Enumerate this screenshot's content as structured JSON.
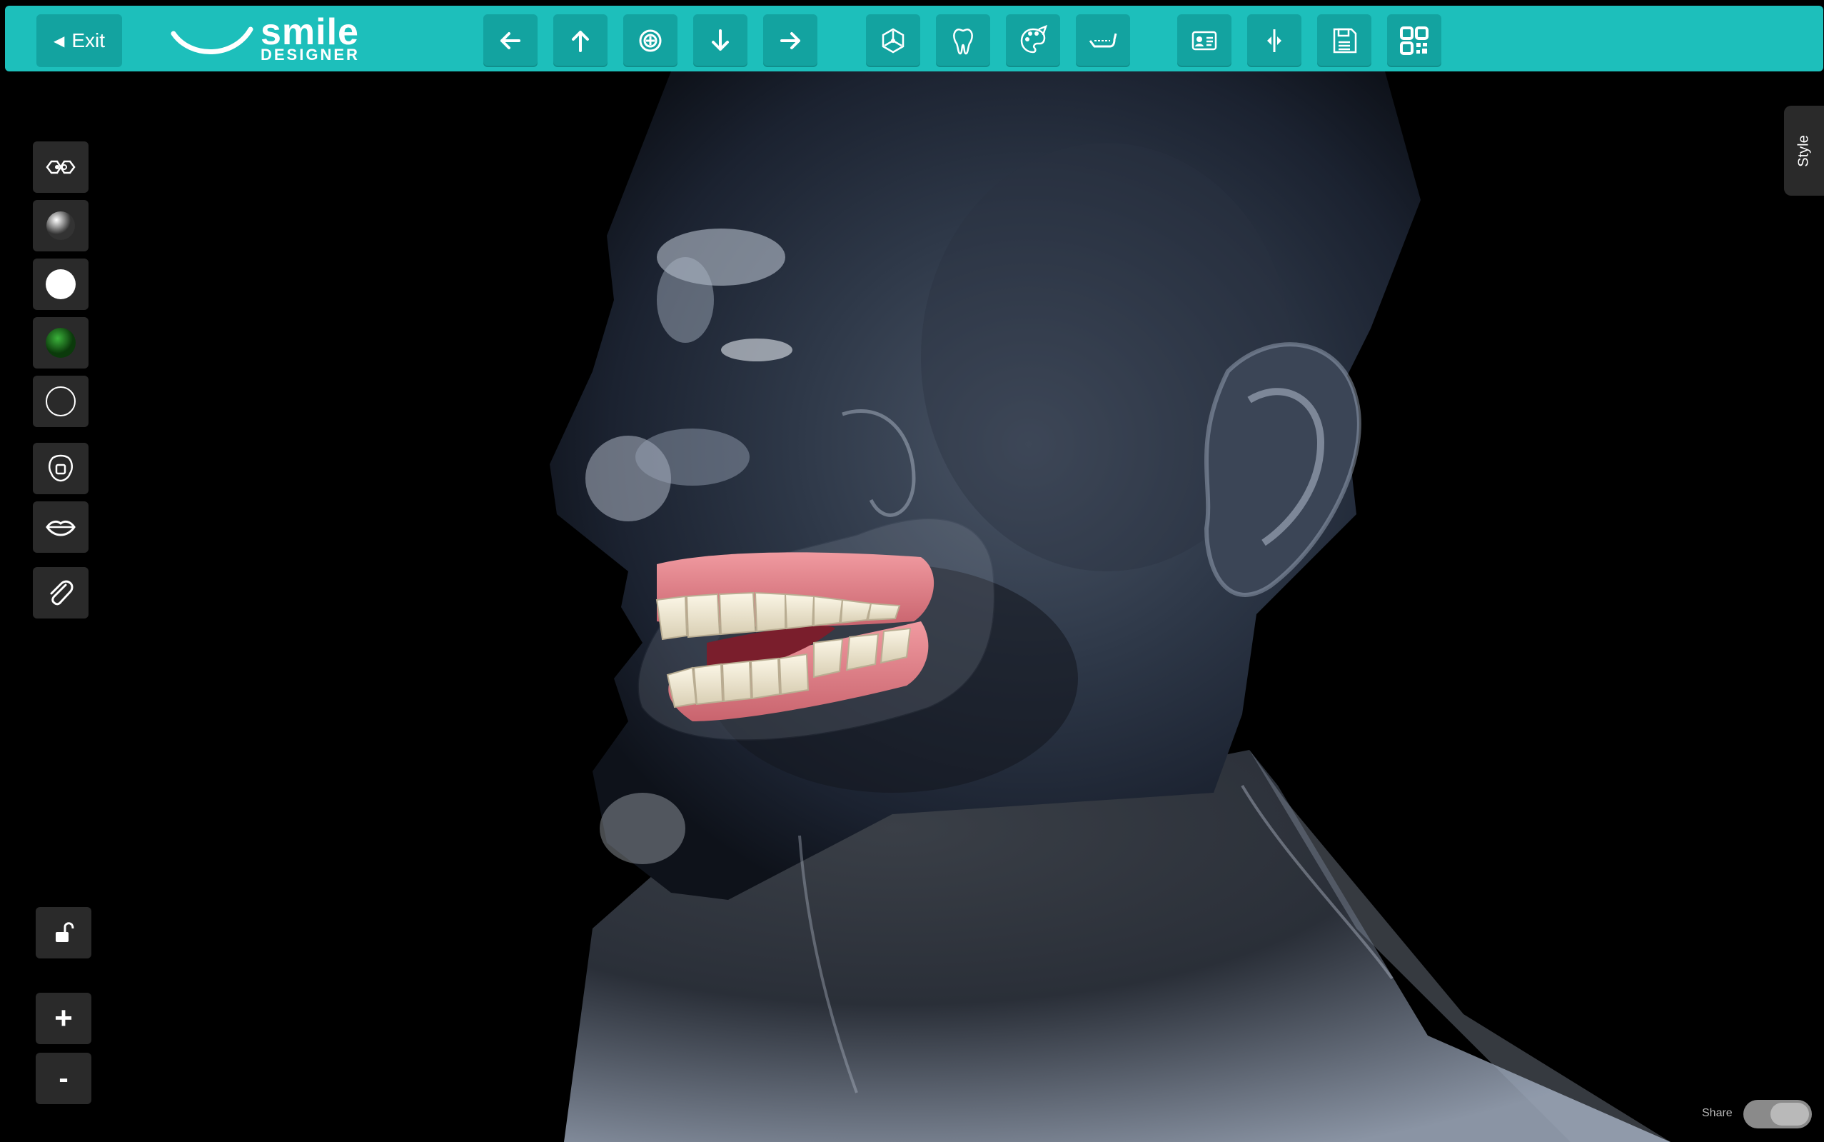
{
  "app": {
    "brand_top": "smile",
    "brand_bottom": "DESIGNER"
  },
  "toolbar": {
    "exit_label": "Exit",
    "buttons": [
      {
        "name": "arrow-left-icon"
      },
      {
        "name": "arrow-up-icon"
      },
      {
        "name": "rotate-center-icon"
      },
      {
        "name": "arrow-down-icon"
      },
      {
        "name": "arrow-right-icon"
      },
      {
        "name": "3d-axes-icon"
      },
      {
        "name": "tooth-icon"
      },
      {
        "name": "palette-icon"
      },
      {
        "name": "jaw-icon"
      },
      {
        "name": "patient-card-icon"
      },
      {
        "name": "split-view-icon"
      },
      {
        "name": "save-icon"
      },
      {
        "name": "qr-code-icon"
      }
    ]
  },
  "left_tools": [
    {
      "name": "toggle-view-icon"
    },
    {
      "name": "material-gray-sphere-icon"
    },
    {
      "name": "material-white-sphere-icon"
    },
    {
      "name": "material-green-sphere-icon"
    },
    {
      "name": "material-outline-sphere-icon"
    },
    {
      "name": "head-mask-icon"
    },
    {
      "name": "lips-icon"
    },
    {
      "name": "paperclip-icon"
    },
    {
      "name": "lock-icon"
    },
    {
      "name": "zoom-in-icon"
    },
    {
      "name": "zoom-out-icon"
    }
  ],
  "zoom": {
    "in_label": "+",
    "out_label": "-"
  },
  "style_tab": {
    "label": "Style"
  },
  "share": {
    "label": "Share",
    "enabled": true
  },
  "colors": {
    "toolbar": "#1dbfbb",
    "toolbar_button": "#13a3a0",
    "panel_button": "#2a2a2a",
    "background": "#000000"
  }
}
